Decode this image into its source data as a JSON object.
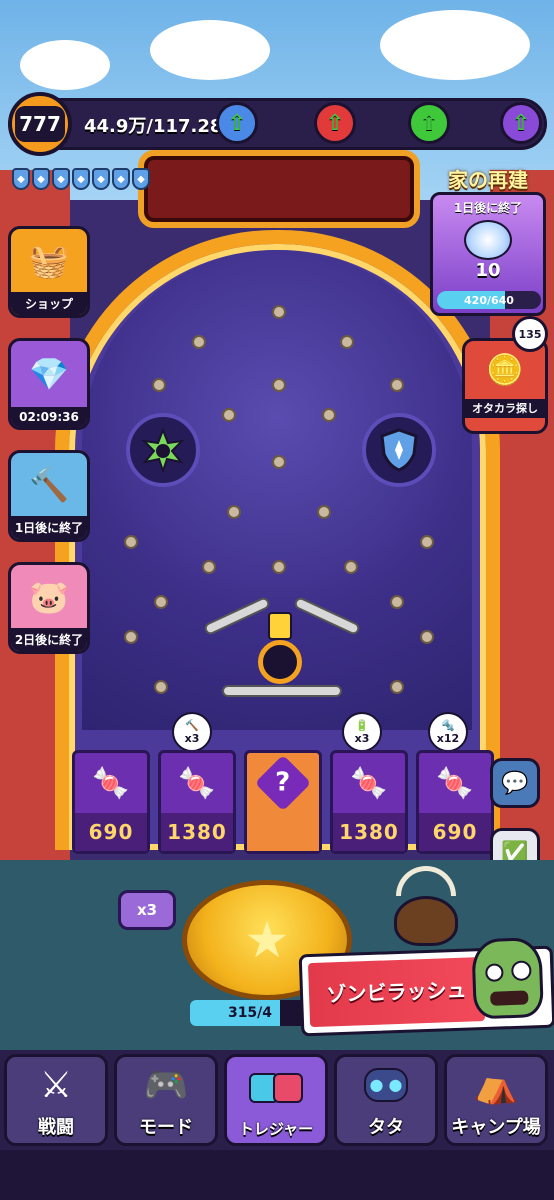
{
  "hud": {
    "level": "777",
    "currency": "44.9万/117.28万",
    "resource_icons": [
      "blue-orb-icon",
      "red-orb-icon",
      "green-orb-icon",
      "purple-orb-icon"
    ]
  },
  "shields": {
    "count": 7
  },
  "left_events": [
    {
      "label": "ショップ",
      "icon": "shop-basket-icon"
    },
    {
      "label": "02:09:36",
      "icon": "gem-chest-icon"
    },
    {
      "label": "1日後に終了",
      "icon": "hammer-icon"
    },
    {
      "label": "2日後に終了",
      "icon": "piggy-bank-icon"
    }
  ],
  "rebuild": {
    "title": "家の再建",
    "timer": "1日後に終了",
    "count": "10",
    "progress_text": "420/640",
    "progress_fraction": 0.656
  },
  "treasure": {
    "label": "オタカラ探し",
    "badge": "135"
  },
  "slots": [
    {
      "value": "690",
      "multiplier": "",
      "icon": "candy-icon"
    },
    {
      "value": "1380",
      "multiplier": "x3",
      "icon": "candy-pile-icon"
    },
    {
      "value": "",
      "multiplier": "",
      "icon": "mystery-icon"
    },
    {
      "value": "1380",
      "multiplier": "x3",
      "icon": "candy-pile-icon"
    },
    {
      "value": "690",
      "multiplier": "x12",
      "icon": "candy-icon"
    }
  ],
  "controls": {
    "multiplier_button": "x3",
    "energy_text": "315/4",
    "energy_fraction": 0.75
  },
  "zombie_event": {
    "label": "ゾンビラッシュ"
  },
  "nav": [
    {
      "label": "戦闘",
      "icon": "swords-icon"
    },
    {
      "label": "モード",
      "icon": "gamepad-icon"
    },
    {
      "label": "トレジャー",
      "icon": "treasure-icon"
    },
    {
      "label": "タタ",
      "icon": "robot-cat-icon"
    },
    {
      "label": "キャンプ場",
      "icon": "tent-icon"
    }
  ],
  "colors": {
    "accent_orange": "#f4a21f",
    "board_purple": "#3d2f88",
    "slot_purple": "#6b2fb0",
    "value_gold": "#ffd66a"
  }
}
